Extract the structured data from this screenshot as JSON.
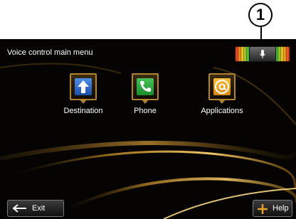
{
  "callout": {
    "number": "1"
  },
  "header": {
    "title": "Voice control main menu"
  },
  "voice_indicator": {
    "icon": "microphone-icon"
  },
  "menu": {
    "items": [
      {
        "label": "Destination",
        "icon": "destination-arrow-icon",
        "color": "#2f6fd0"
      },
      {
        "label": "Phone",
        "icon": "phone-icon",
        "color": "#27a73d"
      },
      {
        "label": "Applications",
        "icon": "at-sign-icon",
        "color": "#f0a21a"
      }
    ]
  },
  "footer": {
    "exit_label": "Exit",
    "exit_icon": "back-arrow-icon",
    "help_label": "Help",
    "help_icon": "plus-icon"
  },
  "colors": {
    "screen_background": "#050403",
    "accent_gold": "#b1842f",
    "text": "#ffffff"
  }
}
